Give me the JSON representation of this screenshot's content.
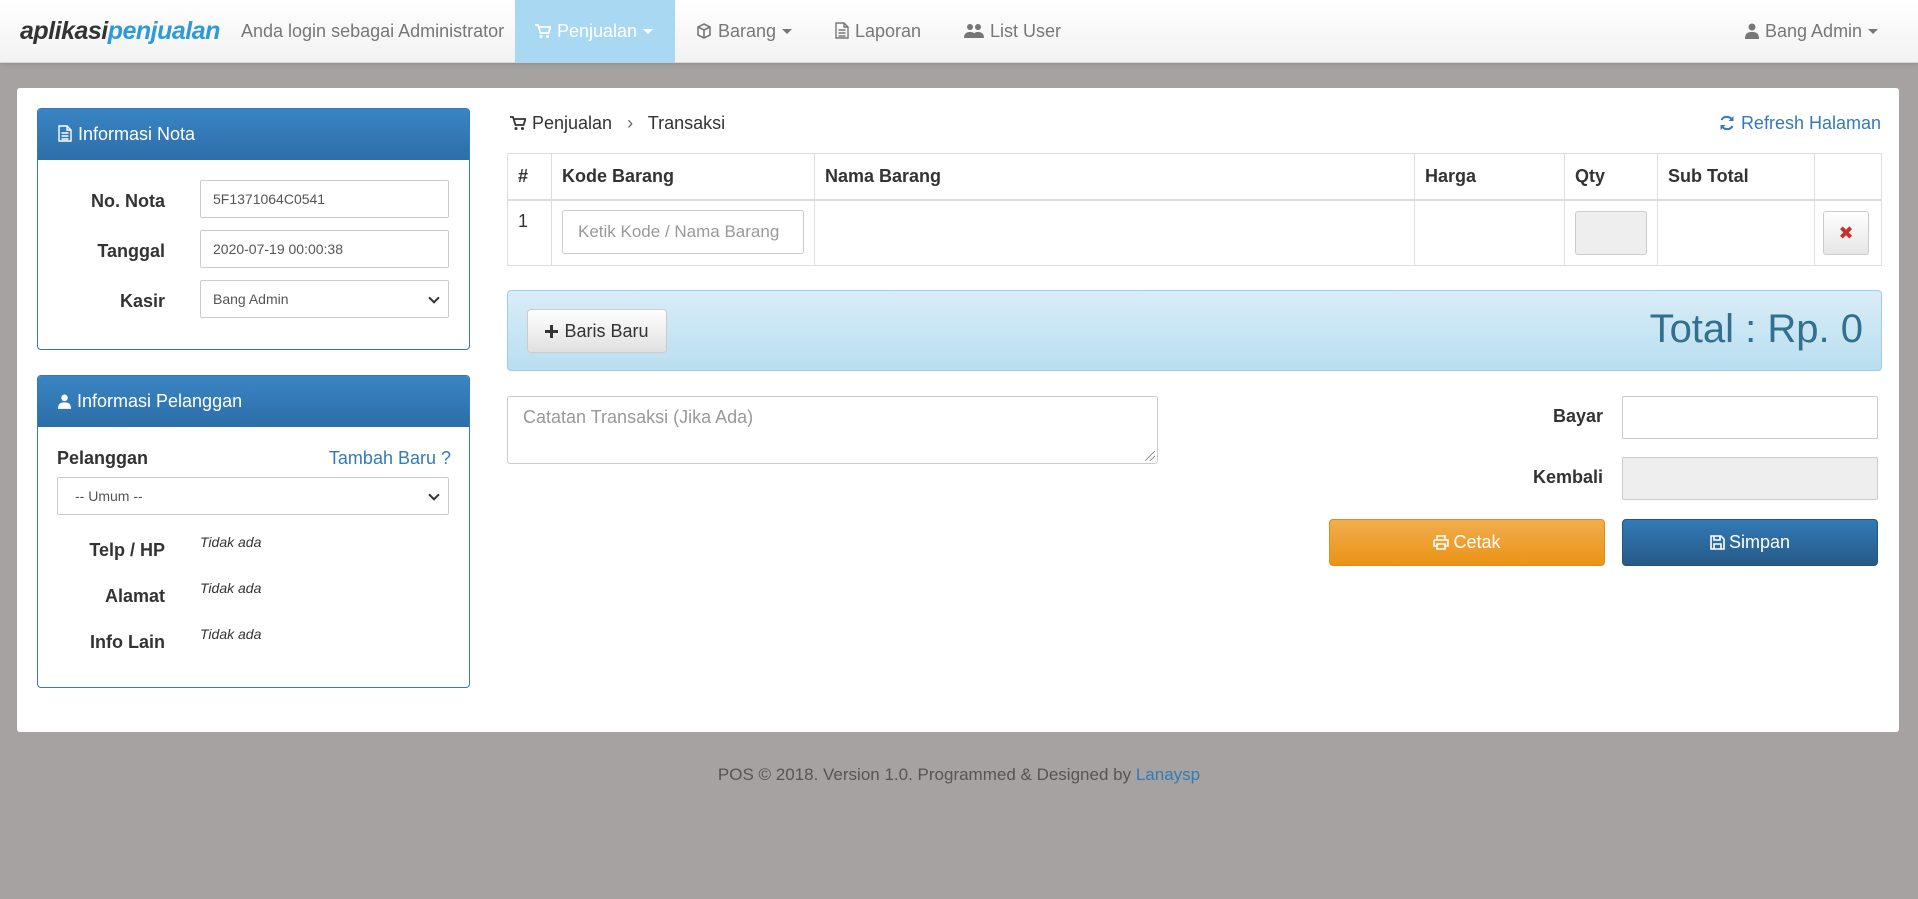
{
  "navbar": {
    "brand_part1": "aplikasi",
    "brand_part2": "penjualan",
    "login_text": "Anda login sebagai Administrator",
    "menu": {
      "penjualan": "Penjualan",
      "barang": "Barang",
      "laporan": "Laporan",
      "list_user": "List User"
    },
    "user_menu": "Bang Admin"
  },
  "nota_panel": {
    "title": "Informasi Nota",
    "no_nota_label": "No. Nota",
    "no_nota_value": "5F1371064C0541",
    "tanggal_label": "Tanggal",
    "tanggal_value": "2020-07-19 00:00:38",
    "kasir_label": "Kasir",
    "kasir_value": "Bang Admin"
  },
  "pelanggan_panel": {
    "title": "Informasi Pelanggan",
    "pelanggan_label": "Pelanggan",
    "tambah_baru_link": "Tambah Baru ?",
    "pelanggan_value": "-- Umum --",
    "telp_label": "Telp / HP",
    "telp_value": "Tidak ada",
    "alamat_label": "Alamat",
    "alamat_value": "Tidak ada",
    "info_label": "Info Lain",
    "info_value": "Tidak ada"
  },
  "breadcrumb": {
    "parent": "Penjualan",
    "separator": "›",
    "current": "Transaksi"
  },
  "refresh_link": "Refresh Halaman",
  "table": {
    "headers": {
      "no": "#",
      "kode": "Kode Barang",
      "nama": "Nama Barang",
      "harga": "Harga",
      "qty": "Qty",
      "subtotal": "Sub Total"
    },
    "rows": [
      {
        "no": "1",
        "kode_placeholder": "Ketik Kode / Nama Barang",
        "delete_icon": "✖"
      }
    ]
  },
  "baris_baru_label": "Baris Baru",
  "total_text": "Total : Rp. 0",
  "catatan_placeholder": "Catatan Transaksi (Jika Ada)",
  "bayar_label": "Bayar",
  "kembali_label": "Kembali",
  "cetak_label": "Cetak",
  "simpan_label": "Simpan",
  "footer": {
    "text": "POS © 2018. Version 1.0. Programmed & Designed by",
    "link": "Lanaysp"
  },
  "colors": {
    "primary": "#337ab7",
    "active_nav": "#a9d8f3",
    "warning": "#f0ad4e",
    "total_text": "#31708f"
  }
}
